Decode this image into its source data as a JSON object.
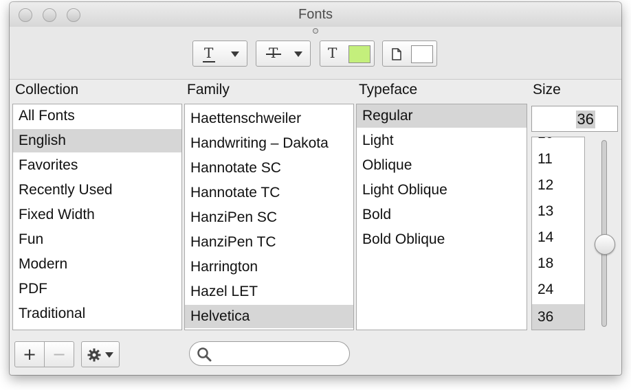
{
  "window": {
    "title": "Fonts"
  },
  "toolbar": {
    "text_color_swatch": "#c4ef7c",
    "document_color_swatch": "#ffffff"
  },
  "collection": {
    "header": "Collection",
    "items": [
      "All Fonts",
      "English",
      "Favorites",
      "Recently Used",
      "Fixed Width",
      "Fun",
      "Modern",
      "PDF",
      "Traditional"
    ],
    "selected": "English"
  },
  "family": {
    "header": "Family",
    "items": [
      "Haettenschweiler",
      "Handwriting – Dakota",
      "Hannotate SC",
      "Hannotate TC",
      "HanziPen SC",
      "HanziPen TC",
      "Harrington",
      "Hazel LET",
      "Helvetica"
    ],
    "selected": "Helvetica"
  },
  "typeface": {
    "header": "Typeface",
    "items": [
      "Regular",
      "Light",
      "Oblique",
      "Light Oblique",
      "Bold",
      "Bold Oblique"
    ],
    "selected": "Regular"
  },
  "size": {
    "header": "Size",
    "value": "36",
    "items": [
      "11",
      "12",
      "13",
      "14",
      "18",
      "24",
      "36"
    ],
    "selected": "36"
  },
  "bottom": {
    "add_label": "+",
    "remove_label": "−"
  }
}
